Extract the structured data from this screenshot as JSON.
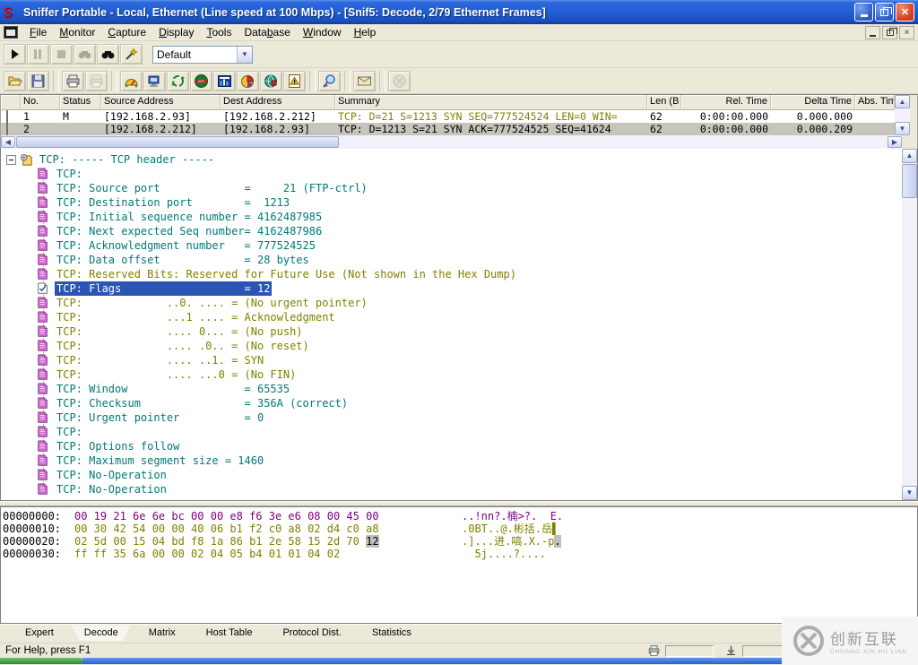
{
  "colors": {
    "teal": "#007878",
    "olive": "#808000",
    "purple": "#800080",
    "selection": "#2B55B4"
  },
  "titlebar": {
    "title": "Sniffer Portable - Local, Ethernet (Line speed at 100 Mbps) - [Snif5: Decode, 2/79 Ethernet Frames]",
    "app_logo_glyph": "S"
  },
  "menubar": {
    "items": [
      {
        "label": "File",
        "accel": 0
      },
      {
        "label": "Monitor",
        "accel": 0
      },
      {
        "label": "Capture",
        "accel": 0
      },
      {
        "label": "Display",
        "accel": 0
      },
      {
        "label": "Tools",
        "accel": 0
      },
      {
        "label": "Database",
        "accel": 4
      },
      {
        "label": "Window",
        "accel": 0
      },
      {
        "label": "Help",
        "accel": 0
      }
    ]
  },
  "toolbars": {
    "row1": [
      {
        "icon": "play-icon",
        "enabled": true
      },
      {
        "icon": "pause-icon",
        "enabled": false
      },
      {
        "icon": "stop-icon",
        "enabled": false
      },
      {
        "icon": "find-next-icon",
        "enabled": false
      },
      {
        "icon": "find-icon",
        "enabled": true
      },
      {
        "icon": "define-filter-icon",
        "enabled": true
      }
    ],
    "filter_combo_value": "Default",
    "row2": [
      {
        "icon": "open-icon",
        "enabled": true
      },
      {
        "icon": "save-icon",
        "enabled": true
      },
      {
        "icon": "sep"
      },
      {
        "icon": "print-icon",
        "enabled": true
      },
      {
        "icon": "print-report-icon",
        "enabled": false
      },
      {
        "icon": "sep"
      },
      {
        "icon": "dashboard-icon",
        "enabled": true
      },
      {
        "icon": "host-table-icon",
        "enabled": true
      },
      {
        "icon": "matrix-icon",
        "enabled": true
      },
      {
        "icon": "art-icon",
        "enabled": true
      },
      {
        "icon": "history-icon",
        "enabled": true
      },
      {
        "icon": "protocol-dist-icon",
        "enabled": true
      },
      {
        "icon": "global-stats-icon",
        "enabled": true
      },
      {
        "icon": "alarm-log-icon",
        "enabled": true
      },
      {
        "icon": "sep"
      },
      {
        "icon": "capture-panel-icon",
        "enabled": true
      },
      {
        "icon": "sep"
      },
      {
        "icon": "mail-icon",
        "enabled": true
      },
      {
        "icon": "sep"
      },
      {
        "icon": "stop-capture-icon",
        "enabled": false
      }
    ]
  },
  "packet_list": {
    "columns": [
      "No.",
      "Status",
      "Source Address",
      "Dest Address",
      "Summary",
      "Len (B",
      "Rel. Time",
      "Delta Time",
      "Abs. Time"
    ],
    "rows": [
      {
        "no": "1",
        "status": "M",
        "source": "[192.168.2.93]",
        "dest": "[192.168.2.212]",
        "summary": "TCP: D=21 S=1213 SYN SEQ=777524524 LEN=0 WIN=",
        "len": "62",
        "rel_time": "0:00:00.000",
        "delta_time": "0.000.000",
        "abs_time": "",
        "selected": false,
        "summary_olive": true
      },
      {
        "no": "2",
        "status": "",
        "source": "[192.168.2.212]",
        "dest": "[192.168.2.93]",
        "summary": "TCP: D=1213 S=21 SYN ACK=777524525 SEQ=41624",
        "len": "62",
        "rel_time": "0:00:00.000",
        "delta_time": "0.000.209",
        "abs_time": "",
        "selected": true,
        "summary_olive": false
      }
    ]
  },
  "decode_tree": {
    "lines": [
      {
        "t": "TCP: ----- TCP header -----",
        "c": "teal",
        "root": true
      },
      {
        "t": "TCP:",
        "c": "teal"
      },
      {
        "t": "TCP: Source port             =     21 (FTP-ctrl)",
        "c": "teal"
      },
      {
        "t": "TCP: Destination port        =  1213",
        "c": "teal"
      },
      {
        "t": "TCP: Initial sequence number = 4162487985",
        "c": "teal"
      },
      {
        "t": "TCP: Next expected Seq number= 4162487986",
        "c": "teal"
      },
      {
        "t": "TCP: Acknowledgment number   = 777524525",
        "c": "teal"
      },
      {
        "t": "TCP: Data offset             = 28 bytes",
        "c": "teal"
      },
      {
        "t": "TCP: Reserved Bits: Reserved for Future Use (Not shown in the Hex Dump)",
        "c": "olive"
      },
      {
        "t": "TCP: Flags                   = 12",
        "c": "teal",
        "sel": true
      },
      {
        "t": "TCP:             ..0. .... = (No urgent pointer)",
        "c": "olive"
      },
      {
        "t": "TCP:             ...1 .... = Acknowledgment",
        "c": "olive"
      },
      {
        "t": "TCP:             .... 0... = (No push)",
        "c": "olive"
      },
      {
        "t": "TCP:             .... .0.. = (No reset)",
        "c": "olive"
      },
      {
        "t": "TCP:             .... ..1. = SYN",
        "c": "olive"
      },
      {
        "t": "TCP:             .... ...0 = (No FIN)",
        "c": "olive"
      },
      {
        "t": "TCP: Window                  = 65535",
        "c": "teal"
      },
      {
        "t": "TCP: Checksum                = 356A (correct)",
        "c": "teal"
      },
      {
        "t": "TCP: Urgent pointer          = 0",
        "c": "teal"
      },
      {
        "t": "TCP:",
        "c": "teal"
      },
      {
        "t": "TCP: Options follow",
        "c": "teal"
      },
      {
        "t": "TCP: Maximum segment size = 1460",
        "c": "teal"
      },
      {
        "t": "TCP: No-Operation",
        "c": "teal"
      },
      {
        "t": "TCP: No-Operation",
        "c": "teal"
      }
    ]
  },
  "hex_dump": {
    "lines": [
      {
        "off": "00000000:",
        "pre": "00 19 21 6e 6e bc 00 00 e8 f6 3e e6 08 00 45 00",
        "hl": "",
        "apre": "..!nn?.楠>?.  E.",
        "ahl": "",
        "c": "purple"
      },
      {
        "off": "00000010:",
        "pre": "00 30 42 54 00 00 40 06 b1 f2 c0 a8 02 d4 c0 a8",
        "hl": "",
        "apre": ".0BT..@.彬括.岳▌",
        "ahl": "",
        "c": "olive"
      },
      {
        "off": "00000020:",
        "pre": "02 5d 00 15 04 bd f8 1a 86 b1 2e 58 15 2d 70 ",
        "hl": "12",
        "apre": ".]...进.嗃.X.-p",
        "ahl": ".",
        "c": "olive"
      },
      {
        "off": "00000030:",
        "pre": "ff ff 35 6a 00 00 02 04 05 b4 01 01 04 02",
        "hl": "",
        "apre": "  5j....?....",
        "ahl": "",
        "c": "olive"
      }
    ]
  },
  "tabs": {
    "items": [
      "Expert",
      "Decode",
      "Matrix",
      "Host Table",
      "Protocol Dist.",
      "Statistics"
    ],
    "active": "Decode"
  },
  "statusbar": {
    "help_text": "For Help, press F1"
  },
  "watermark": {
    "cn": "创新互联",
    "en": "CHUANG XIN HU LIAN"
  }
}
